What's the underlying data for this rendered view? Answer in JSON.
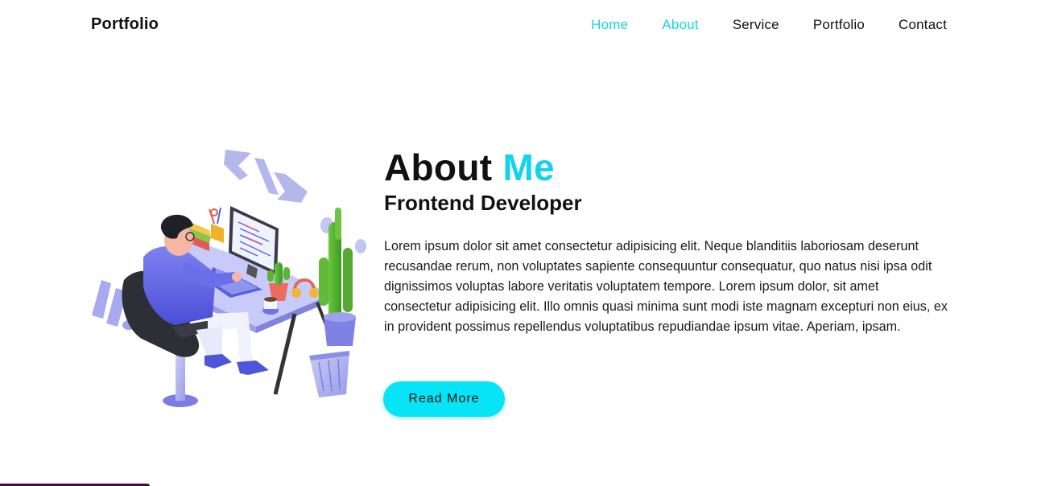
{
  "header": {
    "brand": "Portfolio",
    "nav": [
      {
        "label": "Home",
        "active": true
      },
      {
        "label": "About",
        "active": true
      },
      {
        "label": "Service",
        "active": false
      },
      {
        "label": "Portfolio",
        "active": false
      },
      {
        "label": "Contact",
        "active": false
      }
    ]
  },
  "about": {
    "title_main": "About",
    "title_accent": "Me",
    "subtitle": "Frontend Developer",
    "paragraph": "Lorem ipsum dolor sit amet consectetur adipisicing elit. Neque blanditiis laboriosam deserunt recusandae rerum, non voluptates sapiente consequuntur consequatur, quo natus nisi ipsa odit dignissimos voluptas labore veritatis voluptatem tempore. Lorem ipsum dolor, sit amet consectetur adipisicing elit. Illo omnis quasi minima sunt modi iste magnam excepturi non eius, ex in provident possimus repellendus voluptatibus repudiandae ipsum vitae. Aperiam, ipsam.",
    "button_label": "Read More"
  },
  "colors": {
    "accent": "#13d3ea",
    "button": "#06e4f6",
    "text": "#111111"
  },
  "icons": {
    "illustration": "developer-at-desk-illustration",
    "code_symbol": "code-brackets-icon"
  }
}
